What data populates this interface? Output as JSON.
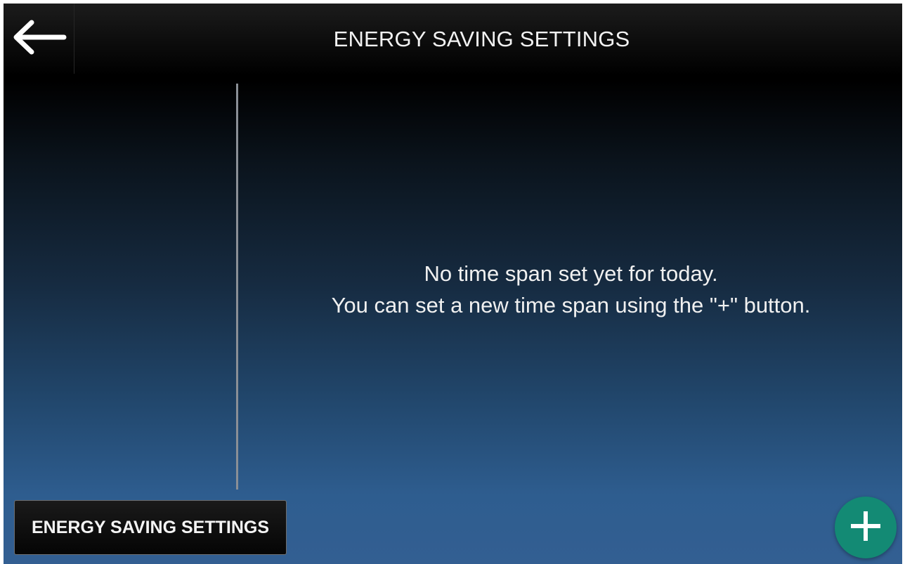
{
  "header": {
    "title": "ENERGY SAVING SETTINGS",
    "back_icon": "arrow-left-icon"
  },
  "main": {
    "message_line1": "No time span set yet for today.",
    "message_line2": "You can set a new time span using the \"+\" button."
  },
  "footer": {
    "tab_label": "ENERGY SAVING SETTINGS",
    "add_icon": "plus-icon"
  },
  "colors": {
    "fab_background": "#138a74",
    "background_top": "#000000",
    "background_bottom": "#335f92",
    "text": "#f0f0f0"
  }
}
